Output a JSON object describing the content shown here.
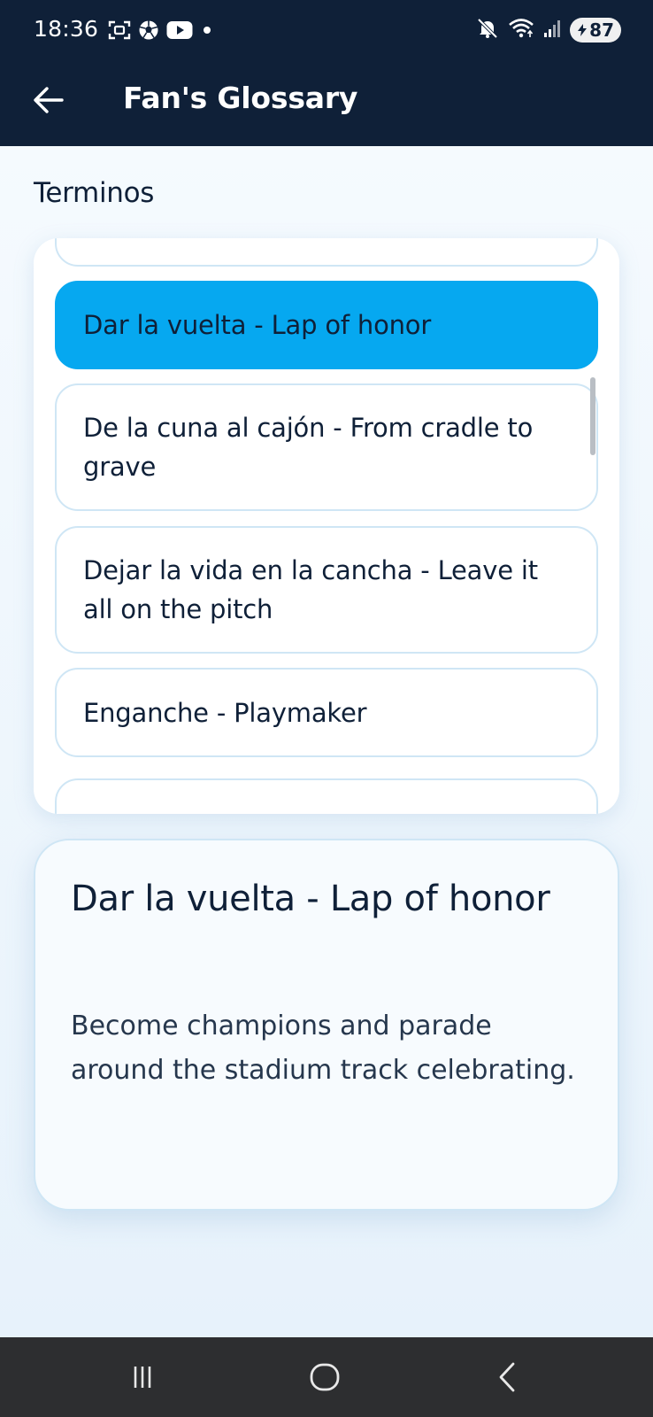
{
  "status_bar": {
    "time": "18:36",
    "battery": "87",
    "icons_left": [
      "screenshot-icon",
      "soccer-ball-icon",
      "youtube-icon",
      "notification-dot-icon"
    ],
    "icons_right": [
      "mute-icon",
      "wifi-icon",
      "signal-icon",
      "battery-icon"
    ]
  },
  "app_bar": {
    "title": "Fan's Glossary",
    "back_icon": "arrow-left-icon"
  },
  "section": {
    "title": "Terminos"
  },
  "terms": [
    {
      "label": "Dar la vuelta - Lap of honor",
      "selected": true
    },
    {
      "label": "De la cuna al cajón - From cradle to grave",
      "selected": false
    },
    {
      "label": "Dejar la vida en la cancha - Leave it all on the pitch",
      "selected": false
    },
    {
      "label": "Enganche - Playmaker",
      "selected": false
    }
  ],
  "detail": {
    "title": "Dar la vuelta - Lap of honor",
    "description": "Become champions and parade around the stadium track celebrating."
  },
  "colors": {
    "header_bg": "#0f2038",
    "selected_bg": "#06a8f0",
    "text_dark": "#0f2038",
    "card_border": "#cfe6f5",
    "nav_bg": "#2d2e30"
  },
  "nav_bar": {
    "icons": [
      "recents-icon",
      "home-icon",
      "back-icon"
    ]
  }
}
